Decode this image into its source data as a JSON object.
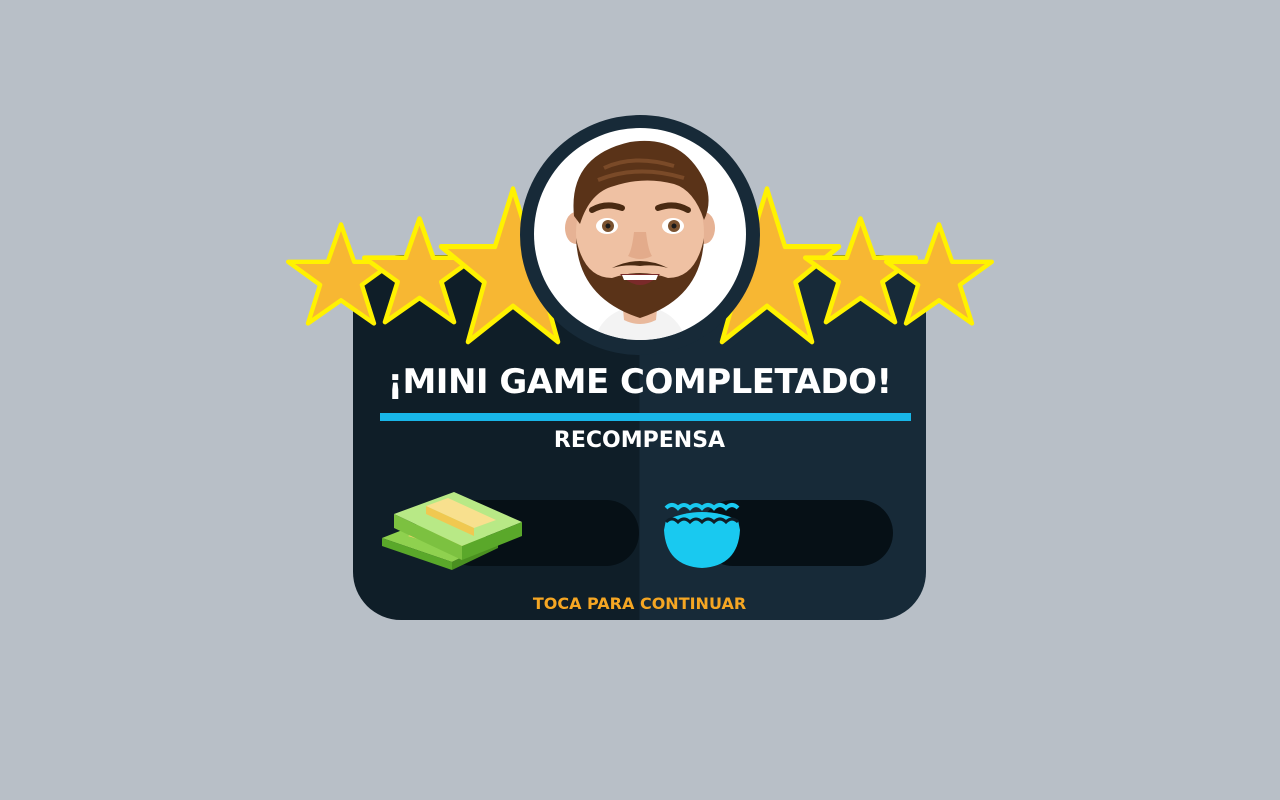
{
  "dialog": {
    "title": "¡MINI GAME COMPLETADO!",
    "subtitle": "RECOMPENSA",
    "continue_label": "TOCA PARA CONTINUAR"
  },
  "rating": {
    "stars_earned": 6,
    "stars_total": 6
  },
  "rewards": [
    {
      "icon": "cash-stack-icon",
      "value": ""
    },
    {
      "icon": "water-icon",
      "value": ""
    }
  ],
  "colors": {
    "background": "#b8bfc7",
    "panel_dark": "#0f1e28",
    "panel_light": "#172a38",
    "accent_blue": "#18b6e8",
    "star_fill": "#f7b733",
    "star_outline": "#fff200",
    "continue_text": "#f5a623"
  }
}
